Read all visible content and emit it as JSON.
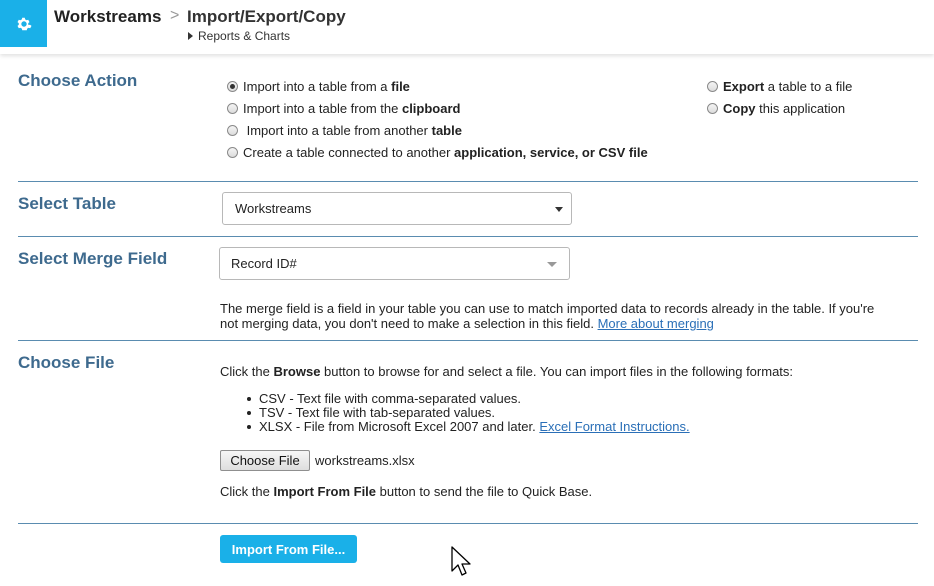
{
  "header": {
    "app_name": "Workstreams",
    "separator": ">",
    "page_title": "Import/Export/Copy",
    "reports_link": "Reports & Charts",
    "icon": "gear-icon"
  },
  "choose_action": {
    "title": "Choose Action",
    "options_left": [
      {
        "pre": "Import into a table from a ",
        "bold": "file",
        "post": "",
        "checked": true
      },
      {
        "pre": "Import into a table from the ",
        "bold": "clipboard",
        "post": "",
        "checked": false
      },
      {
        "pre": " Import into a table from another ",
        "bold": "table",
        "post": "",
        "checked": false
      },
      {
        "pre": "Create a table connected to another ",
        "bold": "application, service, or CSV file",
        "post": "",
        "checked": false
      }
    ],
    "options_right": [
      {
        "pre": "",
        "bold": "Export",
        "post": " a table to a file",
        "checked": false
      },
      {
        "pre": "",
        "bold": "Copy",
        "post": " this application",
        "checked": false
      }
    ]
  },
  "select_table": {
    "title": "Select Table",
    "value": "Workstreams"
  },
  "merge_field": {
    "title": "Select Merge Field",
    "value": "Record ID#",
    "help_line1": "The merge field is a field in your table you can use to match imported data to records already in the table. If you're",
    "help_line2": "not merging data, you don't need to make a selection in this field.",
    "help_link": "More about merging"
  },
  "choose_file": {
    "title": "Choose File",
    "intro_pre": "Click the ",
    "intro_bold": "Browse",
    "intro_post": " button to browse for and select a file. You can import files in the following formats:",
    "formats": [
      "CSV - Text file with comma-separated values.",
      "TSV - Text file with tab-separated values.",
      "XLSX - File from Microsoft Excel 2007 and later."
    ],
    "excel_link": "Excel Format Instructions.",
    "browse_label": "Choose File",
    "file_name": "workstreams.xlsx",
    "outro_pre": "Click the ",
    "outro_bold": "Import From File",
    "outro_post": " button to send the file to Quick Base."
  },
  "footer": {
    "import_button": "Import From File..."
  },
  "colors": {
    "accent": "#1ab0e8",
    "section_title": "#3e6a8e",
    "divider": "#5a8cb0",
    "link": "#2a6fb7"
  }
}
